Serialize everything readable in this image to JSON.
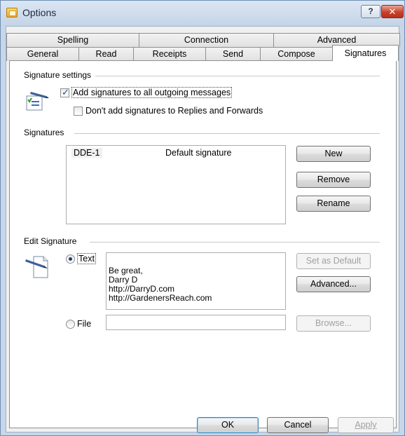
{
  "window": {
    "title": "Options",
    "help_glyph": "?",
    "close_glyph": "✕"
  },
  "tabs": {
    "back_row": [
      "Spelling",
      "Connection",
      "Advanced"
    ],
    "front_row": [
      "General",
      "Read",
      "Receipts",
      "Send",
      "Compose",
      "Signatures"
    ],
    "active": "Signatures"
  },
  "signature_settings": {
    "heading": "Signature settings",
    "add_to_all_label": "Add signatures to all outgoing messages",
    "add_to_all_checked": true,
    "dont_add_label": "Don't add signatures to Replies and Forwards",
    "dont_add_checked": false
  },
  "signatures": {
    "heading": "Signatures",
    "items": [
      {
        "name": "DDE-1",
        "description": "Default signature"
      }
    ],
    "new_button": "New",
    "remove_button": "Remove",
    "rename_button": "Rename"
  },
  "edit_signature": {
    "heading": "Edit Signature",
    "text_option_label": "Text",
    "text_selected": true,
    "file_option_label": "File",
    "file_selected": false,
    "text_lines": [
      "Be great,",
      "Darry D",
      "http://DarryD.com",
      "http://GardenersReach.com"
    ],
    "file_path": "",
    "set_default_button": "Set as Default",
    "advanced_button": "Advanced...",
    "browse_button": "Browse..."
  },
  "footer": {
    "ok_button": "OK",
    "cancel_button": "Cancel",
    "apply_button": "Apply"
  },
  "icons": {
    "title": "options-window-icon",
    "settings": "signature-settings-icon",
    "edit": "edit-signature-icon"
  }
}
